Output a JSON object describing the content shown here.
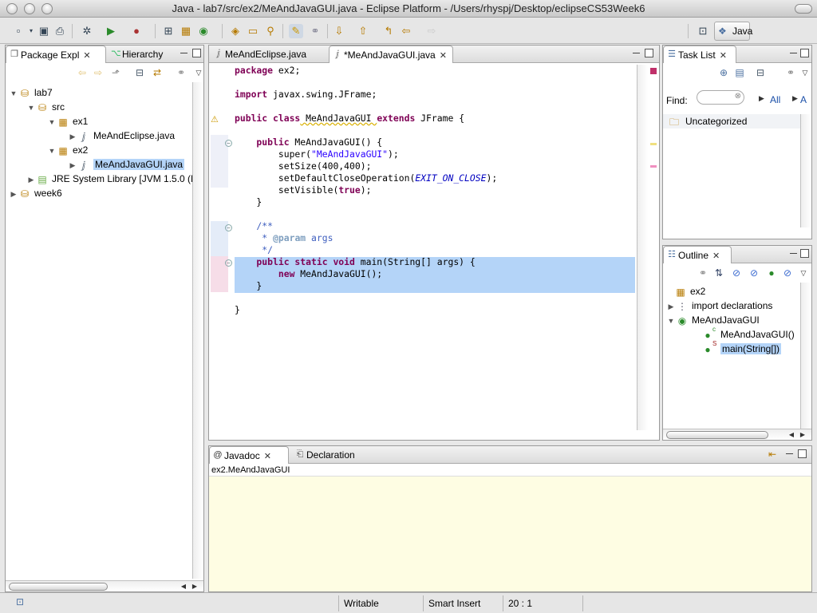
{
  "window": {
    "title": "Java - lab7/src/ex2/MeAndJavaGUI.java - Eclipse Platform - /Users/rhyspj/Desktop/eclipseCS53Week6"
  },
  "perspective": {
    "label": "Java"
  },
  "package_explorer": {
    "tabs": [
      {
        "label": "Package Expl"
      },
      {
        "label": "Hierarchy"
      }
    ],
    "tree": [
      {
        "label": "lab7",
        "icon": "project-icon"
      },
      {
        "label": "src",
        "icon": "source-folder-icon"
      },
      {
        "label": "ex1",
        "icon": "package-icon"
      },
      {
        "label": "MeAndEclipse.java",
        "icon": "java-file-icon"
      },
      {
        "label": "ex2",
        "icon": "package-icon"
      },
      {
        "label": "MeAndJavaGUI.java",
        "icon": "java-file-icon"
      },
      {
        "label": "JRE System Library [JVM 1.5.0 (M",
        "icon": "library-icon"
      },
      {
        "label": "week6",
        "icon": "project-icon"
      }
    ]
  },
  "editor": {
    "tabs": [
      {
        "label": "MeAndEclipse.java"
      },
      {
        "label": "*MeAndJavaGUI.java"
      }
    ],
    "code": {
      "l1a": "package",
      "l1b": " ex2;",
      "l2a": "import",
      "l2b": " javax.swing.JFrame;",
      "l3a": "public class",
      "l3b": " MeAndJavaGUI ",
      "l3c": "extends",
      "l3d": " JFrame {",
      "l4a": "    public",
      "l4b": " MeAndJavaGUI() {",
      "l5a": "        super(",
      "l5b": "\"MeAndJavaGUI\"",
      "l5c": ");",
      "l6": "        setSize(400,400);",
      "l7a": "        setDefaultCloseOperation(",
      "l7b": "EXIT_ON_CLOSE",
      "l7c": ");",
      "l8a": "        setVisible(",
      "l8b": "true",
      "l8c": ");",
      "l9": "    }",
      "l10": "    /**",
      "l11a": "     * ",
      "l11b": "@param",
      "l11c": " args",
      "l12": "     */",
      "l13a": "    public static void",
      "l13b": " main(String[] args) {",
      "l14a": "        new",
      "l14b": " MeAndJavaGUI();",
      "l15": "    }",
      "l16": "}"
    }
  },
  "task_list": {
    "tab_label": "Task List",
    "find_label": "Find:",
    "all_label": "All",
    "activate_label": "A",
    "category": "Uncategorized"
  },
  "outline": {
    "tab_label": "Outline",
    "items": [
      {
        "label": "ex2"
      },
      {
        "label": "import declarations"
      },
      {
        "label": "MeAndJavaGUI"
      },
      {
        "label": "MeAndJavaGUI()",
        "badge": "c"
      },
      {
        "label": "main(String[])",
        "badge": "S"
      }
    ]
  },
  "bottom_panel": {
    "tabs": [
      {
        "label": "Javadoc"
      },
      {
        "label": "Declaration"
      }
    ],
    "javadoc_text": "ex2.MeAndJavaGUI"
  },
  "status": {
    "writable": "Writable",
    "insert_mode": "Smart Insert",
    "position": "20 : 1"
  },
  "colors": {
    "selection": "#b4d4f8",
    "keyword": "#7f0055",
    "string": "#2a00ff",
    "javadoc": "#3f5fbf",
    "javadoc_bg": "#fefde3"
  }
}
